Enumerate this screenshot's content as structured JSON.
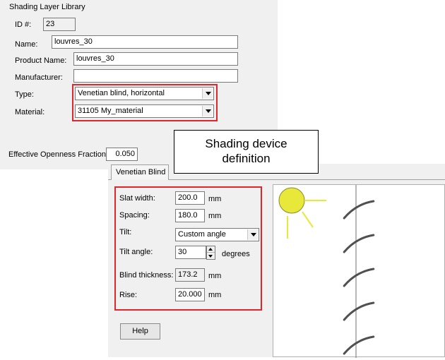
{
  "library": {
    "title": "Shading Layer Library",
    "id_label": "ID #:",
    "id_value": "23",
    "name_label": "Name:",
    "name_value": "louvres_30",
    "product_name_label": "Product Name:",
    "product_name_value": "louvres_30",
    "manufacturer_label": "Manufacturer:",
    "manufacturer_value": "",
    "type_label": "Type:",
    "type_value": "Venetian blind, horizontal",
    "material_label": "Material:",
    "material_value": "31105 My_material",
    "openness_label": "Effective Openness Fraction",
    "openness_value": "0.050"
  },
  "callout": {
    "line1": "Shading device",
    "line2": "definition"
  },
  "blind": {
    "tab_label": "Venetian Blind",
    "slat_width_label": "Slat width:",
    "slat_width_value": "200.0",
    "slat_width_unit": "mm",
    "spacing_label": "Spacing:",
    "spacing_value": "180.0",
    "spacing_unit": "mm",
    "tilt_label": "Tilt:",
    "tilt_value": "Custom angle",
    "tilt_angle_label": "Tilt angle:",
    "tilt_angle_value": "30",
    "tilt_angle_unit": "degrees",
    "thickness_label": "Blind thickness:",
    "thickness_value": "173.2",
    "thickness_unit": "mm",
    "rise_label": "Rise:",
    "rise_value": "20.000",
    "rise_unit": "mm",
    "help_label": "Help"
  },
  "preview": {
    "tilt_degrees": 30,
    "slat_count": 5,
    "sun_color": "#e8e83a",
    "slat_color": "#505050"
  },
  "colors": {
    "highlight_red": "#e0262b",
    "panel_gray": "#f0f0f0"
  }
}
